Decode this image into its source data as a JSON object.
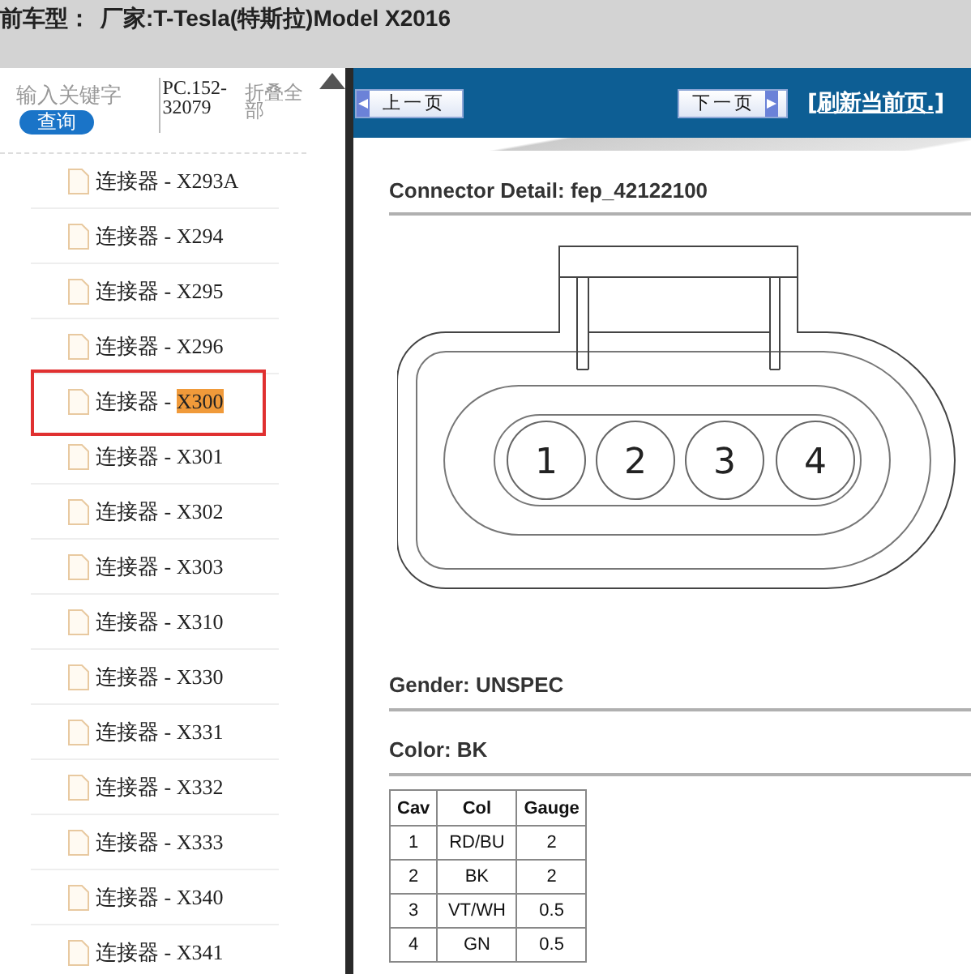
{
  "title_bar": {
    "label": "前车型：",
    "value": "厂家:T-Tesla(特斯拉)Model X2016"
  },
  "sidebar": {
    "search": {
      "placeholder": "输入关键字"
    },
    "search_button": "查询",
    "part_code": "PC.152-32079",
    "collapse_all": "折叠全部",
    "items": [
      {
        "prefix": "连接器 - ",
        "code": "X293A",
        "selected": false
      },
      {
        "prefix": "连接器 - ",
        "code": "X294",
        "selected": false
      },
      {
        "prefix": "连接器 - ",
        "code": "X295",
        "selected": false
      },
      {
        "prefix": "连接器 - ",
        "code": "X296",
        "selected": false
      },
      {
        "prefix": "连接器 - ",
        "code": "X300",
        "selected": true
      },
      {
        "prefix": "连接器 - ",
        "code": "X301",
        "selected": false
      },
      {
        "prefix": "连接器 - ",
        "code": "X302",
        "selected": false
      },
      {
        "prefix": "连接器 - ",
        "code": "X303",
        "selected": false
      },
      {
        "prefix": "连接器 - ",
        "code": "X310",
        "selected": false
      },
      {
        "prefix": "连接器 - ",
        "code": "X330",
        "selected": false
      },
      {
        "prefix": "连接器 - ",
        "code": "X331",
        "selected": false
      },
      {
        "prefix": "连接器 - ",
        "code": "X332",
        "selected": false
      },
      {
        "prefix": "连接器 - ",
        "code": "X333",
        "selected": false
      },
      {
        "prefix": "连接器 - ",
        "code": "X340",
        "selected": false
      },
      {
        "prefix": "连接器 - ",
        "code": "X341",
        "selected": false
      }
    ]
  },
  "nav": {
    "prev": "上一页",
    "next": "下一页",
    "refresh": "[刷新当前页.]"
  },
  "detail": {
    "heading": "Connector Detail: fep_42122100",
    "pins": [
      "1",
      "2",
      "3",
      "4"
    ],
    "gender_label": "Gender: UNSPEC",
    "color_label": "Color: BK",
    "table": {
      "columns": [
        "Cav",
        "Col",
        "Gauge"
      ],
      "rows": [
        [
          "1",
          "RD/BU",
          "2"
        ],
        [
          "2",
          "BK",
          "2"
        ],
        [
          "3",
          "VT/WH",
          "0.5"
        ],
        [
          "4",
          "GN",
          "0.5"
        ]
      ]
    }
  }
}
